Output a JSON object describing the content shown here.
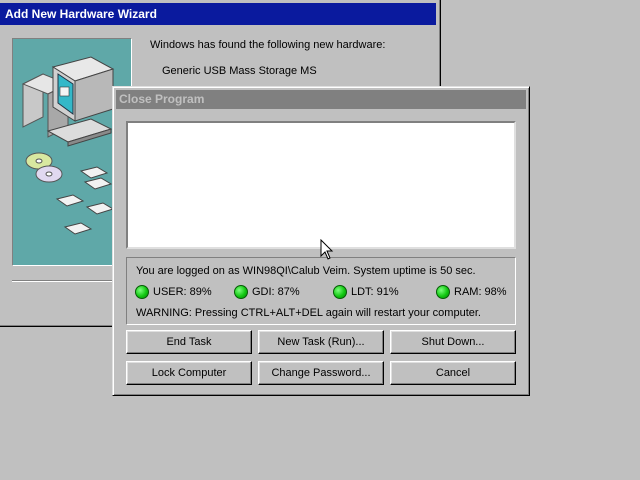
{
  "wizard": {
    "title": "Add New Hardware Wizard",
    "found_text": "Windows has found the following new hardware:",
    "device_name": "Generic USB Mass Storage MS",
    "art_color": "#5fa8a8"
  },
  "dialog": {
    "title": "Close Program",
    "logon_text": "You are logged on as WIN98QI\\Calub Veim. System uptime is 50 sec.",
    "stats": [
      {
        "label": "USER: 89%",
        "icon": "green-status-light-icon"
      },
      {
        "label": "GDI: 87%",
        "icon": "green-status-light-icon"
      },
      {
        "label": "LDT: 91%",
        "icon": "green-status-light-icon"
      },
      {
        "label": "RAM: 98%",
        "icon": "green-status-light-icon"
      }
    ],
    "warning": "WARNING: Pressing CTRL+ALT+DEL again will restart your computer.",
    "buttons": {
      "end_task": "End Task",
      "new_task": "New Task (Run)...",
      "shut_down": "Shut Down...",
      "lock_computer": "Lock Computer",
      "change_password": "Change Password...",
      "cancel": "Cancel"
    }
  },
  "colors": {
    "desktop": "#c0c0c0",
    "active_title": "#0a1a9e",
    "inactive_title": "#808080",
    "status_light": "#12c812"
  }
}
